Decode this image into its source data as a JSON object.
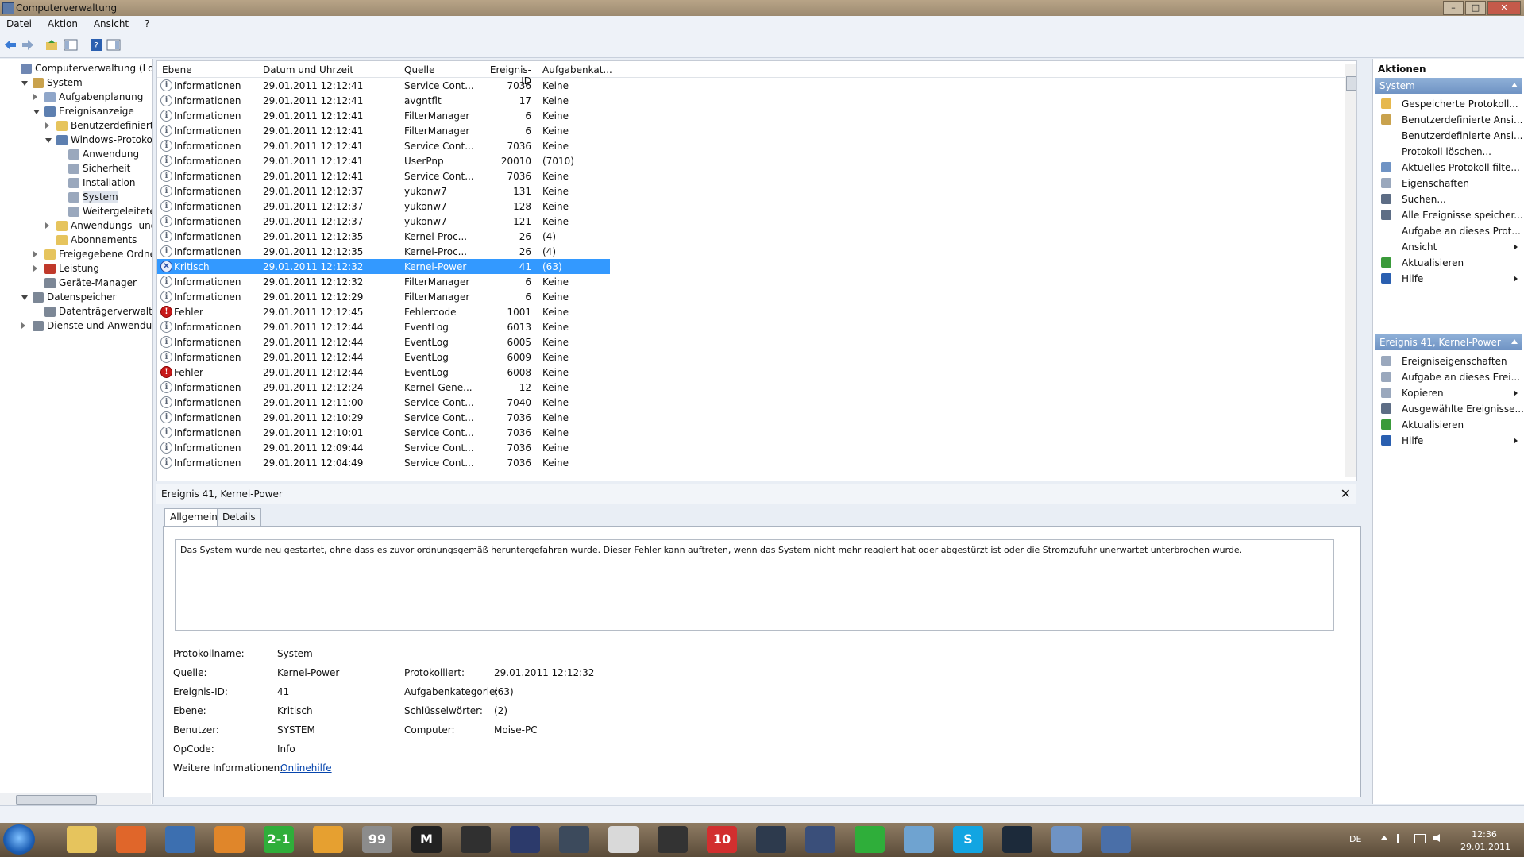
{
  "window": {
    "title": "Computerverwaltung",
    "buttons": [
      "–",
      "□",
      "✕"
    ]
  },
  "menu": [
    "Datei",
    "Aktion",
    "Ansicht",
    "?"
  ],
  "tree": [
    {
      "label": "Computerverwaltung (Lokal)",
      "level": 0,
      "expander": "none",
      "icon": "computer-icon",
      "color": "#6f87b3"
    },
    {
      "label": "System",
      "level": 1,
      "expander": "open",
      "icon": "tools-icon",
      "color": "#c9a24d"
    },
    {
      "label": "Aufgabenplanung",
      "level": 2,
      "expander": "closed",
      "icon": "clock-icon",
      "color": "#8fa6c9"
    },
    {
      "label": "Ereignisanzeige",
      "level": 2,
      "expander": "open",
      "icon": "event-viewer-icon",
      "color": "#5d7fb0"
    },
    {
      "label": "Benutzerdefinierte A",
      "level": 3,
      "expander": "closed",
      "icon": "folder-icon",
      "color": "#e6c45d"
    },
    {
      "label": "Windows-Protokolle",
      "level": 3,
      "expander": "open",
      "icon": "folder-icon",
      "color": "#5d7fb0"
    },
    {
      "label": "Anwendung",
      "level": 4,
      "expander": "none",
      "icon": "log-icon",
      "color": "#9aa8bd"
    },
    {
      "label": "Sicherheit",
      "level": 4,
      "expander": "none",
      "icon": "log-icon",
      "color": "#9aa8bd"
    },
    {
      "label": "Installation",
      "level": 4,
      "expander": "none",
      "icon": "log-icon",
      "color": "#9aa8bd"
    },
    {
      "label": "System",
      "level": 4,
      "expander": "none",
      "icon": "log-icon",
      "color": "#9aa8bd",
      "selected": true
    },
    {
      "label": "Weitergeleitete E",
      "level": 4,
      "expander": "none",
      "icon": "log-icon",
      "color": "#9aa8bd"
    },
    {
      "label": "Anwendungs- und D",
      "level": 3,
      "expander": "closed",
      "icon": "folder-icon",
      "color": "#e6c45d"
    },
    {
      "label": "Abonnements",
      "level": 3,
      "expander": "none",
      "icon": "subscriptions-icon",
      "color": "#e6c45d"
    },
    {
      "label": "Freigegebene Ordner",
      "level": 2,
      "expander": "closed",
      "icon": "shared-folder-icon",
      "color": "#e6c45d"
    },
    {
      "label": "Leistung",
      "level": 2,
      "expander": "closed",
      "icon": "performance-icon",
      "color": "#c0392b"
    },
    {
      "label": "Geräte-Manager",
      "level": 2,
      "expander": "none",
      "icon": "device-manager-icon",
      "color": "#7c8796"
    },
    {
      "label": "Datenspeicher",
      "level": 1,
      "expander": "open",
      "icon": "storage-icon",
      "color": "#7c8796"
    },
    {
      "label": "Datenträgerverwaltung",
      "level": 2,
      "expander": "none",
      "icon": "disk-icon",
      "color": "#7c8796"
    },
    {
      "label": "Dienste und Anwendungen",
      "level": 1,
      "expander": "closed",
      "icon": "services-icon",
      "color": "#7c8796"
    }
  ],
  "columns": [
    "Ebene",
    "Datum und Uhrzeit",
    "Quelle",
    "Ereignis-ID",
    "Aufgabenkat..."
  ],
  "events": [
    {
      "level": "Informationen",
      "type": "info",
      "date": "29.01.2011 12:12:41",
      "source": "Service Cont...",
      "id": "7036",
      "task": "Keine"
    },
    {
      "level": "Informationen",
      "type": "info",
      "date": "29.01.2011 12:12:41",
      "source": "avgntflt",
      "id": "17",
      "task": "Keine"
    },
    {
      "level": "Informationen",
      "type": "info",
      "date": "29.01.2011 12:12:41",
      "source": "FilterManager",
      "id": "6",
      "task": "Keine"
    },
    {
      "level": "Informationen",
      "type": "info",
      "date": "29.01.2011 12:12:41",
      "source": "FilterManager",
      "id": "6",
      "task": "Keine"
    },
    {
      "level": "Informationen",
      "type": "info",
      "date": "29.01.2011 12:12:41",
      "source": "Service Cont...",
      "id": "7036",
      "task": "Keine"
    },
    {
      "level": "Informationen",
      "type": "info",
      "date": "29.01.2011 12:12:41",
      "source": "UserPnp",
      "id": "20010",
      "task": "(7010)"
    },
    {
      "level": "Informationen",
      "type": "info",
      "date": "29.01.2011 12:12:41",
      "source": "Service Cont...",
      "id": "7036",
      "task": "Keine"
    },
    {
      "level": "Informationen",
      "type": "info",
      "date": "29.01.2011 12:12:37",
      "source": "yukonw7",
      "id": "131",
      "task": "Keine"
    },
    {
      "level": "Informationen",
      "type": "info",
      "date": "29.01.2011 12:12:37",
      "source": "yukonw7",
      "id": "128",
      "task": "Keine"
    },
    {
      "level": "Informationen",
      "type": "info",
      "date": "29.01.2011 12:12:37",
      "source": "yukonw7",
      "id": "121",
      "task": "Keine"
    },
    {
      "level": "Informationen",
      "type": "info",
      "date": "29.01.2011 12:12:35",
      "source": "Kernel-Proc...",
      "id": "26",
      "task": "(4)"
    },
    {
      "level": "Informationen",
      "type": "info",
      "date": "29.01.2011 12:12:35",
      "source": "Kernel-Proc...",
      "id": "26",
      "task": "(4)"
    },
    {
      "level": "Kritisch",
      "type": "critical",
      "date": "29.01.2011 12:12:32",
      "source": "Kernel-Power",
      "id": "41",
      "task": "(63)",
      "selected": true
    },
    {
      "level": "Informationen",
      "type": "info",
      "date": "29.01.2011 12:12:32",
      "source": "FilterManager",
      "id": "6",
      "task": "Keine"
    },
    {
      "level": "Informationen",
      "type": "info",
      "date": "29.01.2011 12:12:29",
      "source": "FilterManager",
      "id": "6",
      "task": "Keine"
    },
    {
      "level": "Fehler",
      "type": "error",
      "date": "29.01.2011 12:12:45",
      "source": "Fehlercode",
      "id": "1001",
      "task": "Keine"
    },
    {
      "level": "Informationen",
      "type": "info",
      "date": "29.01.2011 12:12:44",
      "source": "EventLog",
      "id": "6013",
      "task": "Keine"
    },
    {
      "level": "Informationen",
      "type": "info",
      "date": "29.01.2011 12:12:44",
      "source": "EventLog",
      "id": "6005",
      "task": "Keine"
    },
    {
      "level": "Informationen",
      "type": "info",
      "date": "29.01.2011 12:12:44",
      "source": "EventLog",
      "id": "6009",
      "task": "Keine"
    },
    {
      "level": "Fehler",
      "type": "error",
      "date": "29.01.2011 12:12:44",
      "source": "EventLog",
      "id": "6008",
      "task": "Keine"
    },
    {
      "level": "Informationen",
      "type": "info",
      "date": "29.01.2011 12:12:24",
      "source": "Kernel-Gene...",
      "id": "12",
      "task": "Keine"
    },
    {
      "level": "Informationen",
      "type": "info",
      "date": "29.01.2011 12:11:00",
      "source": "Service Cont...",
      "id": "7040",
      "task": "Keine"
    },
    {
      "level": "Informationen",
      "type": "info",
      "date": "29.01.2011 12:10:29",
      "source": "Service Cont...",
      "id": "7036",
      "task": "Keine"
    },
    {
      "level": "Informationen",
      "type": "info",
      "date": "29.01.2011 12:10:01",
      "source": "Service Cont...",
      "id": "7036",
      "task": "Keine"
    },
    {
      "level": "Informationen",
      "type": "info",
      "date": "29.01.2011 12:09:44",
      "source": "Service Cont...",
      "id": "7036",
      "task": "Keine"
    },
    {
      "level": "Informationen",
      "type": "info",
      "date": "29.01.2011 12:04:49",
      "source": "Service Cont...",
      "id": "7036",
      "task": "Keine"
    }
  ],
  "detail": {
    "title": "Ereignis 41, Kernel-Power",
    "close": "✕",
    "tabs": [
      "Allgemein",
      "Details"
    ],
    "description": "Das System wurde neu gestartet, ohne dass es zuvor ordnungsgemäß heruntergefahren wurde. Dieser Fehler kann auftreten, wenn das System nicht mehr reagiert hat oder abgestürzt ist oder die Stromzufuhr unerwartet unterbrochen wurde.",
    "protokollname_label": "Protokollname:",
    "protokollname": "System",
    "quelle_label": "Quelle:",
    "quelle": "Kernel-Power",
    "protokolliert_label": "Protokolliert:",
    "protokolliert": "29.01.2011 12:12:32",
    "ereignisid_label": "Ereignis-ID:",
    "ereignisid": "41",
    "aufgabenkategorie_label": "Aufgabenkategorie:",
    "aufgabenkategorie": "(63)",
    "ebene_label": "Ebene:",
    "ebene": "Kritisch",
    "schluesselwoerter_label": "Schlüsselwörter:",
    "schluesselwoerter": "(2)",
    "benutzer_label": "Benutzer:",
    "benutzer": "SYSTEM",
    "computer_label": "Computer:",
    "computer": "Moise-PC",
    "opcode_label": "OpCode:",
    "opcode": "Info",
    "weitere_label": "Weitere Informationen:",
    "weitere_link": "Onlinehilfe"
  },
  "actions": {
    "title": "Aktionen",
    "section1": "System",
    "items1": [
      {
        "label": "Gespeicherte Protokoll...",
        "icon": "folder-open-icon",
        "color": "#e6b84d",
        "arrow": false
      },
      {
        "label": "Benutzerdefinierte Ansi...",
        "icon": "filter-icon",
        "color": "#c9a24d",
        "arrow": false
      },
      {
        "label": "Benutzerdefinierte Ansi...",
        "icon": "none",
        "color": "",
        "arrow": false
      },
      {
        "label": "Protokoll löschen...",
        "icon": "none",
        "color": "",
        "arrow": false
      },
      {
        "label": "Aktuelles Protokoll filte...",
        "icon": "filter-icon",
        "color": "#6f93c4",
        "arrow": false
      },
      {
        "label": "Eigenschaften",
        "icon": "properties-icon",
        "color": "#9aa8bd",
        "arrow": false
      },
      {
        "label": "Suchen...",
        "icon": "binoculars-icon",
        "color": "#5d6d85",
        "arrow": false
      },
      {
        "label": "Alle Ereignisse speicher...",
        "icon": "save-icon",
        "color": "#5d6d85",
        "arrow": false
      },
      {
        "label": "Aufgabe an dieses Prot...",
        "icon": "none",
        "color": "",
        "arrow": false
      },
      {
        "label": "Ansicht",
        "icon": "none",
        "color": "",
        "arrow": true
      },
      {
        "label": "Aktualisieren",
        "icon": "refresh-icon",
        "color": "#3a9a3a",
        "arrow": false
      },
      {
        "label": "Hilfe",
        "icon": "help-icon",
        "color": "#2a5fb0",
        "arrow": true
      }
    ],
    "section2": "Ereignis 41, Kernel-Power",
    "items2": [
      {
        "label": "Ereigniseigenschaften",
        "icon": "properties-icon",
        "color": "#9aa8bd",
        "arrow": false
      },
      {
        "label": "Aufgabe an dieses Erei...",
        "icon": "task-icon",
        "color": "#9aa8bd",
        "arrow": false
      },
      {
        "label": "Kopieren",
        "icon": "copy-icon",
        "color": "#9aa8bd",
        "arrow": true
      },
      {
        "label": "Ausgewählte Ereignisse...",
        "icon": "save-icon",
        "color": "#5d6d85",
        "arrow": false
      },
      {
        "label": "Aktualisieren",
        "icon": "refresh-icon",
        "color": "#3a9a3a",
        "arrow": false
      },
      {
        "label": "Hilfe",
        "icon": "help-icon",
        "color": "#2a5fb0",
        "arrow": true
      }
    ]
  },
  "taskbar": {
    "apps": [
      {
        "name": "explorer-icon",
        "color": "#e6c45d"
      },
      {
        "name": "firefox-icon",
        "color": "#e0662a"
      },
      {
        "name": "thunderbird-icon",
        "color": "#3c6fb0"
      },
      {
        "name": "media-player-icon",
        "color": "#e0862a"
      },
      {
        "name": "game-2-1-icon",
        "color": "#2fae3a",
        "text": "2-1"
      },
      {
        "name": "info-app-icon",
        "color": "#e6a030"
      },
      {
        "name": "notepad-99-icon",
        "color": "#8c8c8c",
        "text": "99"
      },
      {
        "name": "m-app-icon",
        "color": "#222222",
        "text": "M"
      },
      {
        "name": "darth-vader-icon",
        "color": "#303030"
      },
      {
        "name": "shield-game-icon",
        "color": "#2c3a6b"
      },
      {
        "name": "starcraft-icon",
        "color": "#3c4a5c"
      },
      {
        "name": "pencil-icon",
        "color": "#d9d9d9"
      },
      {
        "name": "helmet-icon",
        "color": "#333333"
      },
      {
        "name": "ten-icon",
        "color": "#d22f2f",
        "text": "10"
      },
      {
        "name": "starcraft2-icon",
        "color": "#2d3a4d"
      },
      {
        "name": "moon-icon",
        "color": "#3a4f7a"
      },
      {
        "name": "play-icon",
        "color": "#2fae3a"
      },
      {
        "name": "people-icon",
        "color": "#6fa3d0"
      },
      {
        "name": "skype-icon",
        "color": "#12a5e2",
        "text": "S"
      },
      {
        "name": "fan-icon",
        "color": "#1c2a3a"
      },
      {
        "name": "control-panel-icon",
        "color": "#6f93c4"
      },
      {
        "name": "computer-management-icon",
        "color": "#4a6fa8"
      }
    ],
    "lang": "DE",
    "time": "12:36",
    "date": "29.01.2011"
  }
}
